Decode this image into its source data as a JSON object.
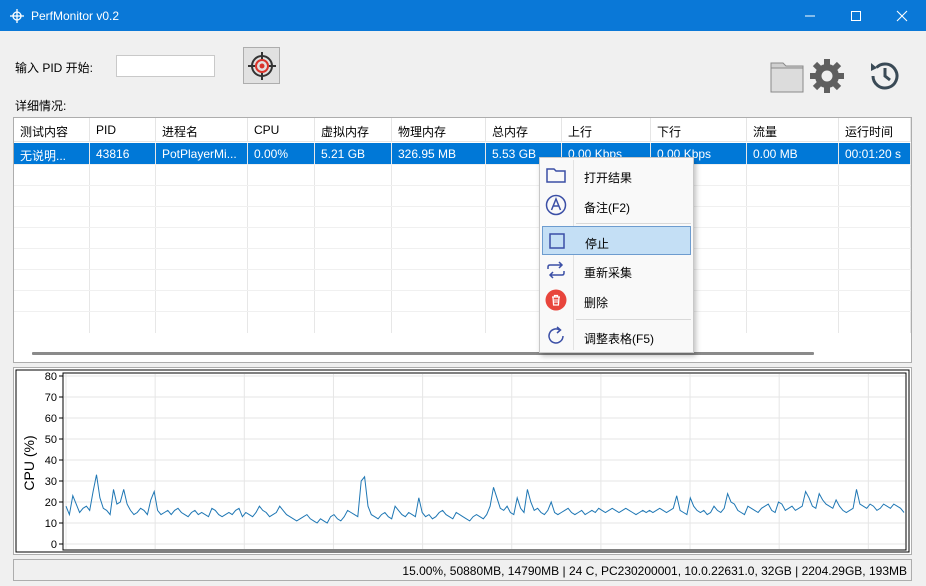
{
  "window": {
    "title": "PerfMonitor v0.2"
  },
  "controls": {
    "pid_label": "输入 PID 开始:",
    "pid_value": "",
    "details_label": "详细情况:"
  },
  "table": {
    "columns": [
      "测试内容",
      "PID",
      "进程名",
      "CPU",
      "虚拟内存",
      "物理内存",
      "总内存",
      "上行",
      "下行",
      "流量",
      "运行时间"
    ],
    "rows": [
      [
        "无说明...",
        "43816",
        "PotPlayerMi...",
        "0.00%",
        "5.21 GB",
        "326.95 MB",
        "5.53 GB",
        "0.00 Kbps",
        "0.00 Kbps",
        "0.00 MB",
        "00:01:20 s"
      ]
    ]
  },
  "context_menu": {
    "items": [
      {
        "label": "打开结果",
        "icon": "folder-icon"
      },
      {
        "label": "备注(F2)",
        "icon": "annotate-icon"
      },
      {
        "label": "停止",
        "icon": "stop-icon",
        "highlighted": true
      },
      {
        "label": "重新采集",
        "icon": "repeat-icon"
      },
      {
        "label": "删除",
        "icon": "delete-icon"
      },
      {
        "label": "调整表格(F5)",
        "icon": "refresh-icon"
      }
    ]
  },
  "status_bar": {
    "text": "15.00%, 50880MB, 14790MB | 24 C, PC230200001, 10.0.22631.0, 32GB | 2204.29GB, 193MB"
  },
  "colors": {
    "titlebar": "#0a78d7",
    "selection": "#0078d7",
    "line": "#1f77b4",
    "menu_highlight": "#c4dff5"
  },
  "chart_data": {
    "type": "line",
    "ylabel": "CPU (%)",
    "ylim": [
      0,
      80
    ],
    "yticks": [
      0,
      10,
      20,
      30,
      40,
      50,
      60,
      70,
      80
    ],
    "grid": true,
    "series": [
      {
        "values": [
          18,
          14,
          23,
          19,
          15,
          17,
          18,
          16,
          25,
          33,
          22,
          17,
          16,
          14,
          26,
          19,
          20,
          26,
          19,
          16,
          14,
          15,
          17,
          16,
          14,
          21,
          25,
          16,
          14,
          15,
          16,
          14,
          16,
          17,
          15,
          14,
          13,
          15,
          16,
          14,
          15,
          14,
          13,
          17,
          16,
          14,
          13,
          14,
          15,
          14,
          16,
          17,
          13,
          15,
          14,
          13,
          15,
          18,
          16,
          15,
          13,
          14,
          15,
          18,
          16,
          14,
          13,
          12,
          11,
          12,
          13,
          14,
          12,
          11,
          10,
          12,
          11,
          10,
          13,
          14,
          12,
          11,
          13,
          16,
          15,
          14,
          13,
          30,
          32,
          18,
          14,
          13,
          12,
          14,
          15,
          13,
          12,
          18,
          16,
          14,
          13,
          15,
          14,
          13,
          22,
          15,
          13,
          14,
          12,
          13,
          15,
          16,
          14,
          13,
          12,
          15,
          14,
          13,
          12,
          11,
          13,
          14,
          13,
          12,
          14,
          18,
          27,
          22,
          17,
          16,
          18,
          15,
          14,
          22,
          17,
          15,
          26,
          20,
          16,
          17,
          15,
          14,
          16,
          20,
          15,
          14,
          15,
          16,
          17,
          15,
          14,
          15,
          16,
          14,
          15,
          16,
          15,
          17,
          16,
          15,
          16,
          17,
          16,
          15,
          16,
          17,
          16,
          15,
          14,
          15,
          16,
          15,
          16,
          15,
          16,
          17,
          16,
          15,
          16,
          17,
          23,
          16,
          15,
          14,
          22,
          18,
          16,
          15,
          16,
          14,
          15,
          18,
          16,
          15,
          17,
          24,
          20,
          19,
          16,
          15,
          14,
          18,
          17,
          16,
          15,
          17,
          18,
          19,
          16,
          15,
          20,
          19,
          16,
          17,
          18,
          16,
          17,
          18,
          25,
          22,
          18,
          17,
          24,
          21,
          19,
          18,
          17,
          21,
          18,
          16,
          15,
          16,
          17,
          26,
          19,
          18,
          17,
          19,
          18,
          16,
          17,
          19,
          18,
          17,
          19,
          18,
          17,
          15
        ]
      }
    ]
  }
}
